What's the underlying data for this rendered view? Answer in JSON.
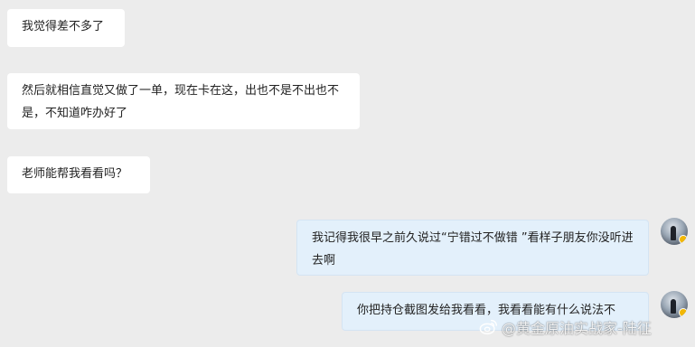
{
  "messages": [
    {
      "side": "incoming",
      "text": "我觉得差不多了"
    },
    {
      "side": "incoming",
      "text": "然后就相信直觉又做了一单，现在卡在这，出也不是不出也不是，不知道咋办好了"
    },
    {
      "side": "incoming",
      "text": "老师能帮我看看吗？"
    },
    {
      "side": "outgoing",
      "text": "我记得我很早之前久说过“宁错过不做错 ”看样子朋友你没听进去啊"
    },
    {
      "side": "outgoing",
      "text": "你把持仓截图发给我看看，我看看能有什么说法不"
    }
  ],
  "watermark": {
    "text": "@黄金原油实战家-陆征",
    "icon": "weibo-icon"
  }
}
